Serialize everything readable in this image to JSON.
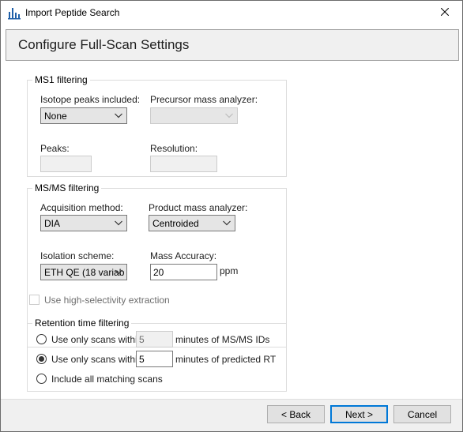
{
  "window": {
    "title": "Import Peptide Search"
  },
  "banner": {
    "title": "Configure Full-Scan Settings"
  },
  "ms1": {
    "legend": "MS1 filtering",
    "isotope_label": "Isotope peaks included:",
    "isotope_value": "None",
    "precursor_label": "Precursor mass analyzer:",
    "precursor_value": "",
    "peaks_label": "Peaks:",
    "peaks_value": "",
    "resolution_label": "Resolution:",
    "resolution_value": ""
  },
  "msms": {
    "legend": "MS/MS filtering",
    "acquisition_label": "Acquisition method:",
    "acquisition_value": "DIA",
    "product_label": "Product mass analyzer:",
    "product_value": "Centroided",
    "isolation_label": "Isolation scheme:",
    "isolation_value": "ETH QE (18 variab",
    "mass_accuracy_label": "Mass Accuracy:",
    "mass_accuracy_value": "20",
    "mass_accuracy_unit": "ppm"
  },
  "high_selectivity": {
    "label": "Use high-selectivity extraction",
    "checked": false
  },
  "retention": {
    "legend": "Retention time filtering",
    "opt1_label": "Use only scans within",
    "opt1_value": "5",
    "opt1_suffix": "minutes of MS/MS IDs",
    "opt2_label": "Use only scans within",
    "opt2_value": "5",
    "opt2_suffix": "minutes of predicted RT",
    "opt3_label": "Include all matching scans",
    "selected": "opt2"
  },
  "footer": {
    "back": "< Back",
    "next": "Next >",
    "cancel": "Cancel"
  },
  "icons": {
    "app": "skyline-icon",
    "close": "close-icon",
    "dropdown": "chevron-down-icon"
  },
  "colors": {
    "accent": "#0078d7",
    "app_icon": "#1f5fa8"
  }
}
